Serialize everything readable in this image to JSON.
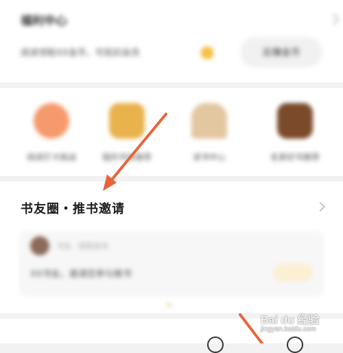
{
  "welfare": {
    "title": "福利中心",
    "desc": "阅读领取XX金币，可抵扣会员",
    "earn_button": "去赚金币"
  },
  "shortcuts": [
    {
      "label": "阅读打卡挑战",
      "icon": "orange-circle-icon"
    },
    {
      "label": "我的书单推荐",
      "icon": "book-icon"
    },
    {
      "label": "读书中心",
      "icon": "house-icon"
    },
    {
      "label": "名家好书推荐",
      "icon": "book-cover-icon"
    }
  ],
  "bookcircle": {
    "title": "书友圈・推书邀请",
    "post_meta": "书友 · 刚刚发布",
    "post_text": "XX书友，邀请您参与推书"
  },
  "watermark": {
    "brand": "Bai du 经验",
    "sub": "jingyan.baidu.com"
  },
  "colors": {
    "annotation_arrow": "#e8643b",
    "coin": "#f6c343"
  }
}
